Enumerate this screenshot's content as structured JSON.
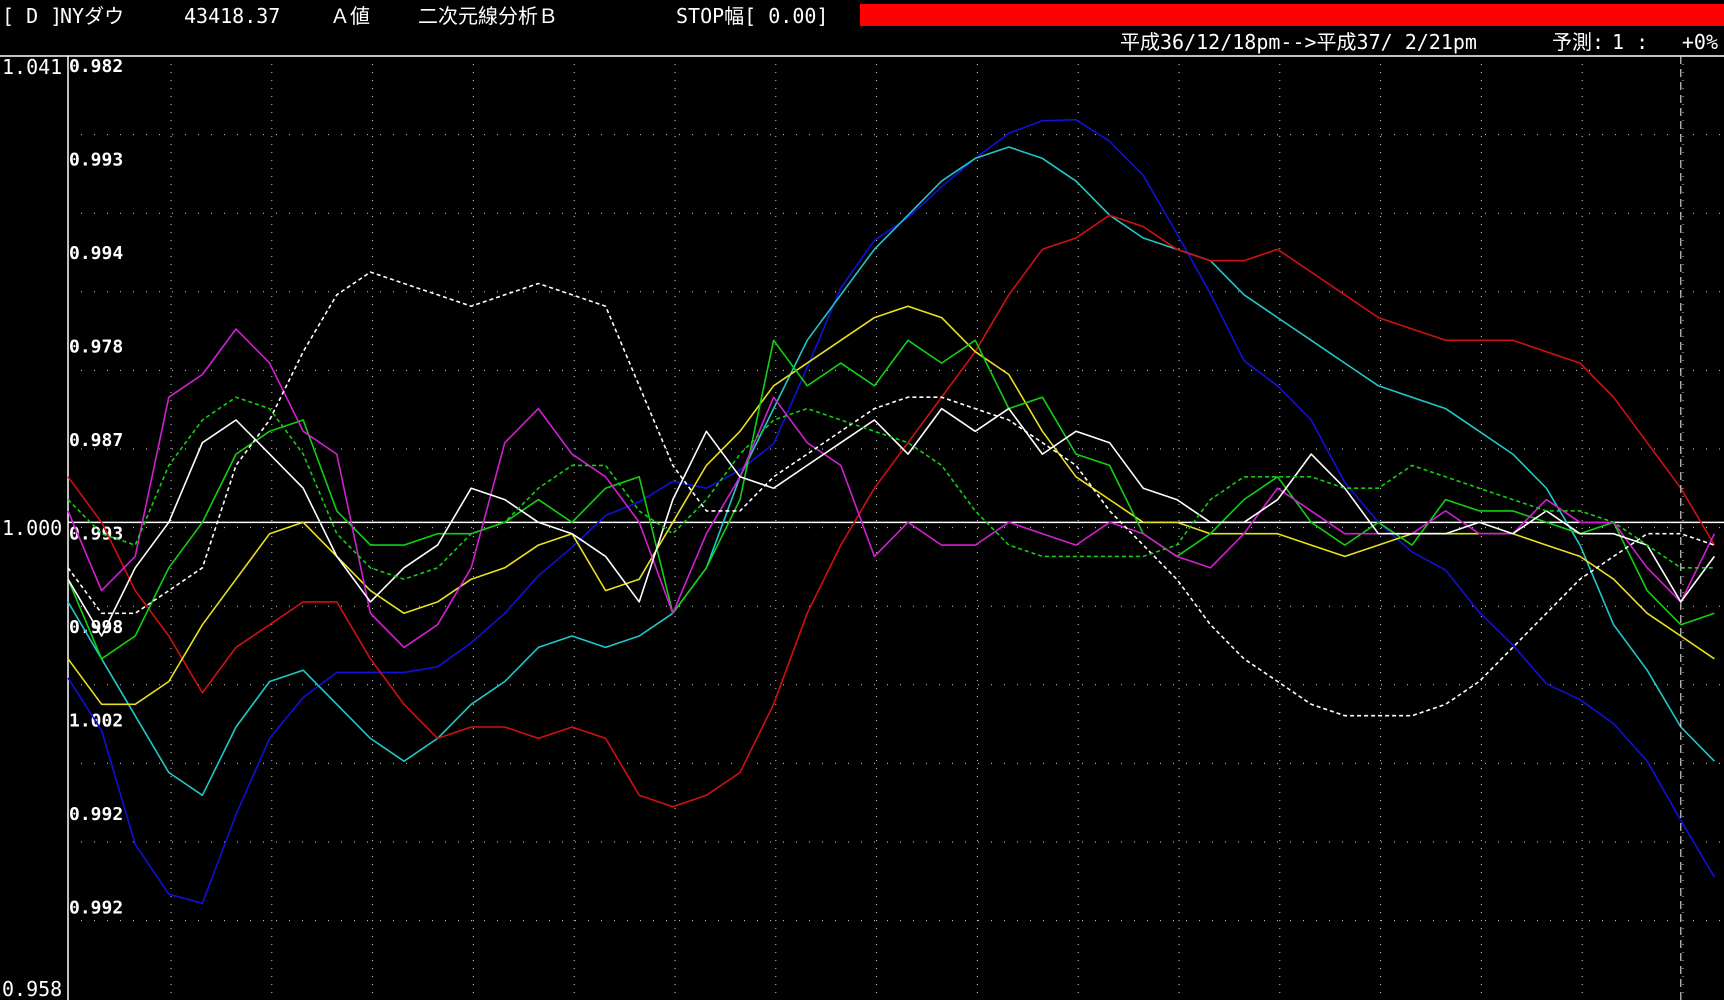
{
  "header": {
    "mode": "[ D ]",
    "instrument": "NYダウ",
    "price": "43418.37",
    "value_type": "Ａ値",
    "analysis": "二次元線分析Ｂ",
    "stop": "STOP幅[ 0.00]",
    "stop_bar_color": "#ff0000",
    "period": "平成36/12/18pm-->平成37/ 2/21pm",
    "forecast_label": "予測:",
    "forecast_value": "1 :",
    "forecast_pct": "+0%"
  },
  "chart_data": {
    "type": "line",
    "x": [
      0,
      1,
      2,
      3,
      4,
      5,
      6,
      7,
      8,
      9,
      10,
      11,
      12,
      13,
      14,
      15,
      16,
      17,
      18,
      19,
      20,
      21,
      22,
      23,
      24,
      25,
      26,
      27,
      28,
      29,
      30,
      31,
      32,
      33,
      34,
      35,
      36,
      37,
      38,
      39,
      40,
      41,
      42,
      43,
      44,
      45,
      46,
      47,
      48,
      49
    ],
    "ylim": [
      0.958,
      1.041
    ],
    "outer_ticks": [
      "1.041",
      "1.000",
      "0.958"
    ],
    "baseline": 1.0,
    "inner_ticks": [
      "0.982",
      "0.993",
      "0.994",
      "0.978",
      "0.987",
      "0.993",
      "0.998",
      "1.002",
      "0.992",
      "0.992"
    ],
    "forecast_marker_x": 48,
    "grid": true,
    "series": [
      {
        "color": "#1010d8",
        "dashed": false,
        "values": [
          0.9863,
          0.9817,
          0.9717,
          0.9673,
          0.9665,
          0.9743,
          0.981,
          0.9846,
          0.9868,
          0.9868,
          0.9868,
          0.9873,
          0.9894,
          0.992,
          0.9953,
          0.9978,
          1.0006,
          1.0018,
          1.0036,
          1.003,
          1.0046,
          1.0069,
          1.0136,
          1.0206,
          1.0248,
          1.0268,
          1.0295,
          1.032,
          1.0342,
          1.0353,
          1.0354,
          1.0335,
          1.0305,
          1.0254,
          1.0201,
          1.0142,
          1.012,
          1.009,
          1.0035,
          1.0,
          0.9974,
          0.9958,
          0.9921,
          0.9892,
          0.9858,
          0.9844,
          0.9823,
          0.979,
          0.9738,
          0.9688
        ]
      },
      {
        "color": "#20c8c8",
        "dashed": false,
        "values": [
          0.993,
          0.988,
          0.983,
          0.978,
          0.976,
          0.982,
          0.986,
          0.987,
          0.984,
          0.981,
          0.979,
          0.981,
          0.984,
          0.986,
          0.989,
          0.99,
          0.989,
          0.99,
          0.992,
          0.996,
          1.004,
          1.01,
          1.016,
          1.02,
          1.024,
          1.027,
          1.03,
          1.032,
          1.033,
          1.032,
          1.03,
          1.027,
          1.025,
          1.024,
          1.023,
          1.02,
          1.018,
          1.016,
          1.014,
          1.012,
          1.011,
          1.01,
          1.008,
          1.006,
          1.003,
          0.998,
          0.991,
          0.987,
          0.982,
          0.979
        ]
      },
      {
        "color": "#d01010",
        "dashed": false,
        "values": [
          1.004,
          1.0,
          0.994,
          0.99,
          0.985,
          0.989,
          0.991,
          0.993,
          0.993,
          0.988,
          0.984,
          0.981,
          0.982,
          0.982,
          0.981,
          0.982,
          0.981,
          0.976,
          0.975,
          0.976,
          0.978,
          0.984,
          0.992,
          0.998,
          1.003,
          1.007,
          1.011,
          1.015,
          1.02,
          1.024,
          1.025,
          1.027,
          1.026,
          1.024,
          1.023,
          1.023,
          1.024,
          1.022,
          1.02,
          1.018,
          1.017,
          1.016,
          1.016,
          1.016,
          1.015,
          1.014,
          1.011,
          1.007,
          1.003,
          0.998
        ]
      },
      {
        "color": "#e8e020",
        "dashed": false,
        "values": [
          0.988,
          0.984,
          0.984,
          0.986,
          0.991,
          0.995,
          0.999,
          1.0,
          0.997,
          0.994,
          0.992,
          0.993,
          0.995,
          0.996,
          0.998,
          0.999,
          0.994,
          0.995,
          1.0,
          1.005,
          1.008,
          1.012,
          1.014,
          1.016,
          1.018,
          1.019,
          1.018,
          1.015,
          1.013,
          1.008,
          1.004,
          1.002,
          1.0,
          1.0,
          0.999,
          0.999,
          0.999,
          0.998,
          0.997,
          0.998,
          0.999,
          0.999,
          0.999,
          0.999,
          0.998,
          0.997,
          0.995,
          0.992,
          0.99,
          0.988
        ]
      },
      {
        "color": "#10d010",
        "dashed": false,
        "values": [
          0.995,
          0.988,
          0.99,
          0.996,
          1.0,
          1.006,
          1.008,
          1.009,
          1.001,
          0.998,
          0.998,
          0.999,
          0.999,
          1.0,
          1.002,
          1.0,
          1.003,
          1.004,
          0.992,
          0.996,
          1.002,
          1.016,
          1.012,
          1.014,
          1.012,
          1.016,
          1.014,
          1.016,
          1.01,
          1.011,
          1.006,
          1.005,
          0.999,
          0.997,
          0.999,
          1.002,
          1.004,
          1.0,
          0.998,
          1.0,
          0.998,
          1.002,
          1.001,
          1.001,
          1.0,
          0.999,
          1.0,
          0.994,
          0.991,
          0.992
        ]
      },
      {
        "color": "#d020d0",
        "dashed": false,
        "values": [
          1.001,
          0.994,
          0.997,
          1.011,
          1.013,
          1.017,
          1.014,
          1.008,
          1.006,
          0.992,
          0.989,
          0.991,
          0.996,
          1.007,
          1.01,
          1.006,
          1.004,
          1.0,
          0.992,
          0.999,
          1.004,
          1.011,
          1.007,
          1.005,
          0.997,
          1.0,
          0.998,
          0.998,
          1.0,
          0.999,
          0.998,
          1.0,
          0.999,
          0.997,
          0.996,
          0.999,
          1.003,
          1.001,
          0.999,
          0.999,
          0.999,
          1.001,
          0.999,
          0.999,
          1.002,
          1.0,
          1.0,
          0.996,
          0.993,
          0.999
        ]
      },
      {
        "color": "#ffffff",
        "dashed": false,
        "values": [
          0.995,
          0.99,
          0.996,
          1.0,
          1.007,
          1.009,
          1.006,
          1.003,
          0.997,
          0.993,
          0.996,
          0.998,
          1.003,
          1.002,
          1.0,
          0.999,
          0.997,
          0.993,
          1.002,
          1.008,
          1.004,
          1.003,
          1.005,
          1.007,
          1.009,
          1.006,
          1.01,
          1.008,
          1.01,
          1.006,
          1.008,
          1.007,
          1.003,
          1.002,
          1.0,
          1.0,
          1.002,
          1.006,
          1.003,
          0.999,
          0.999,
          0.999,
          1.0,
          0.999,
          1.001,
          0.999,
          0.999,
          0.998,
          0.993,
          0.997
        ]
      },
      {
        "color": "#ffffff",
        "dashed": true,
        "values": [
          0.996,
          0.992,
          0.992,
          0.994,
          0.996,
          1.005,
          1.009,
          1.015,
          1.02,
          1.022,
          1.021,
          1.02,
          1.019,
          1.02,
          1.021,
          1.02,
          1.019,
          1.012,
          1.005,
          1.001,
          1.001,
          1.004,
          1.006,
          1.008,
          1.01,
          1.011,
          1.011,
          1.01,
          1.009,
          1.007,
          1.005,
          1.001,
          0.998,
          0.995,
          0.991,
          0.988,
          0.986,
          0.984,
          0.983,
          0.983,
          0.983,
          0.984,
          0.986,
          0.989,
          0.992,
          0.995,
          0.997,
          0.999,
          0.999,
          0.998
        ]
      },
      {
        "color": "#10d010",
        "dashed": true,
        "values": [
          1.002,
          0.999,
          0.998,
          1.005,
          1.009,
          1.011,
          1.01,
          1.006,
          0.999,
          0.996,
          0.995,
          0.996,
          0.999,
          1.0,
          1.003,
          1.005,
          1.005,
          1.001,
          0.999,
          1.002,
          1.006,
          1.009,
          1.01,
          1.009,
          1.008,
          1.007,
          1.005,
          1.001,
          0.998,
          0.997,
          0.997,
          0.997,
          0.997,
          0.998,
          1.002,
          1.004,
          1.004,
          1.004,
          1.003,
          1.003,
          1.005,
          1.004,
          1.003,
          1.002,
          1.001,
          1.001,
          1.0,
          0.998,
          0.996,
          0.996
        ]
      }
    ]
  }
}
